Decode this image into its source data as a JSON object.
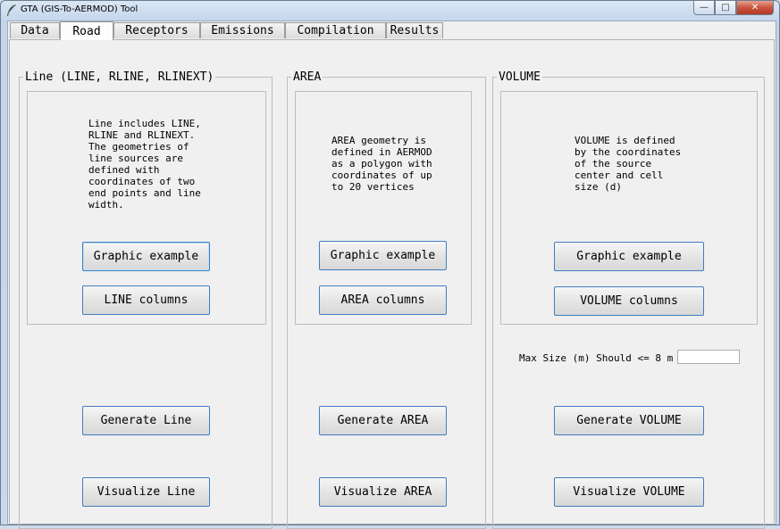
{
  "window": {
    "title": "GTA (GIS-To-AERMOD) Tool"
  },
  "tabs": [
    {
      "label": "Data"
    },
    {
      "label": "Road"
    },
    {
      "label": "Receptors"
    },
    {
      "label": "Emissions"
    },
    {
      "label": "Compilation"
    },
    {
      "label": "Results"
    }
  ],
  "active_tab": "Road",
  "line": {
    "title": "Line (LINE, RLINE, RLINEXT)",
    "description": "Line includes LINE,\nRLINE and RLINEXT.\nThe geometries of\nline sources are\ndefined with\ncoordinates of two\nend points and line\nwidth.",
    "graphic_example": "Graphic example",
    "columns": "LINE columns",
    "generate": "Generate Line",
    "visualize": "Visualize Line"
  },
  "area": {
    "title": "AREA",
    "description": "AREA geometry is\ndefined in AERMOD\nas a polygon with\ncoordinates of up\nto 20 vertices",
    "graphic_example": "Graphic example",
    "columns": "AREA columns",
    "generate": "Generate AREA",
    "visualize": "Visualize AREA"
  },
  "volume": {
    "title": "VOLUME",
    "description": "VOLUME is defined\nby the coordinates\nof the source\ncenter and cell\nsize (d)",
    "graphic_example": "Graphic example",
    "columns": "VOLUME columns",
    "max_size_label": "Max Size (m) Should <= 8 m",
    "max_size_value": "",
    "generate": "Generate VOLUME",
    "visualize": "Visualize VOLUME"
  }
}
